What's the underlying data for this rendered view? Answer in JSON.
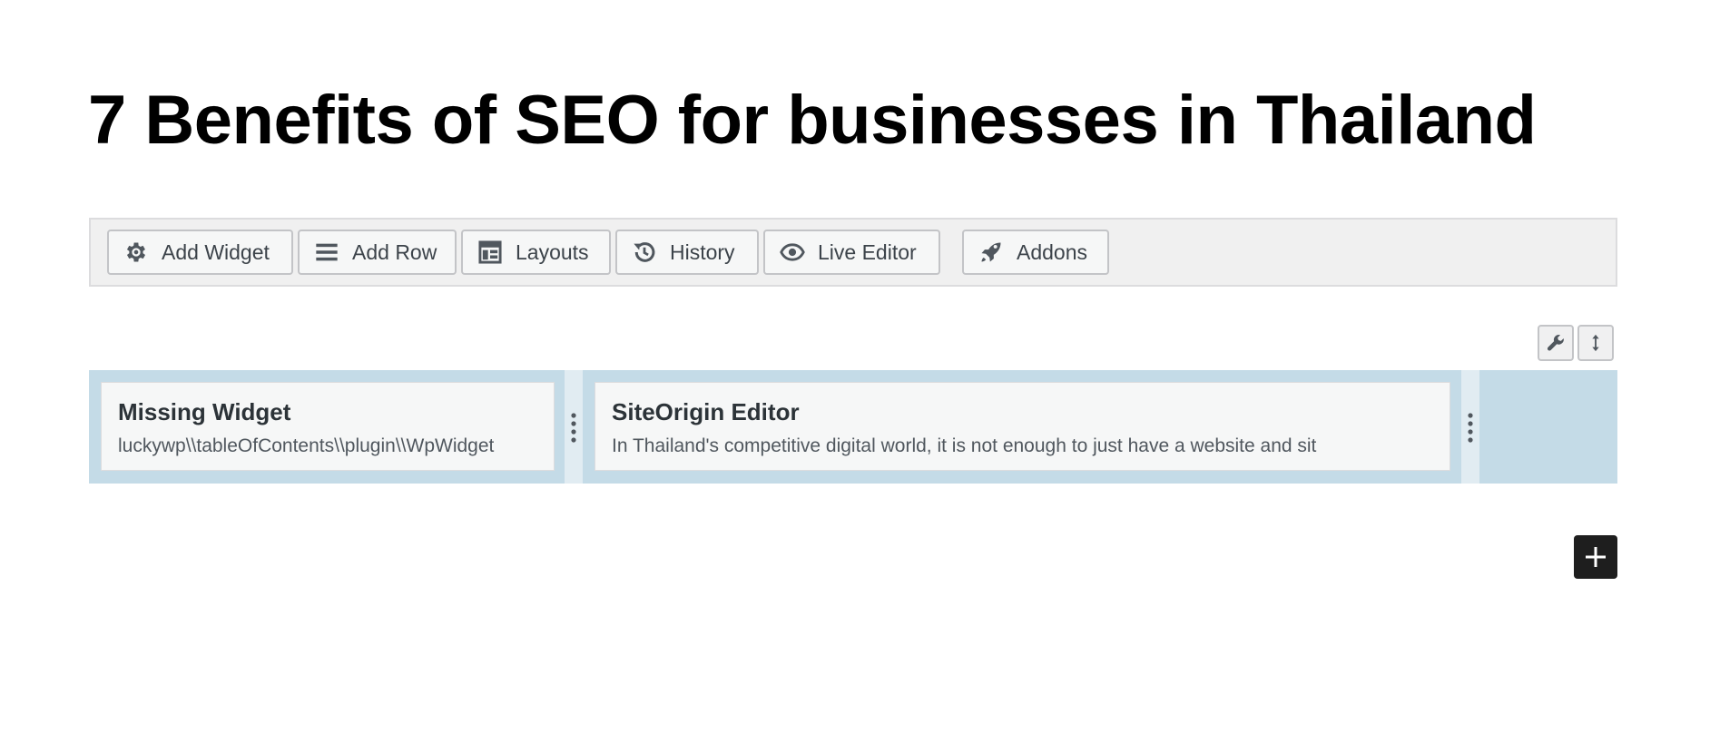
{
  "post": {
    "title": "7 Benefits of SEO for businesses in Thailand"
  },
  "toolbar": {
    "buttons": [
      {
        "label": "Add Widget",
        "icon": "gear-icon"
      },
      {
        "label": "Add Row",
        "icon": "hamburger-icon"
      },
      {
        "label": "Layouts",
        "icon": "layout-icon"
      },
      {
        "label": "History",
        "icon": "history-icon"
      },
      {
        "label": "Live Editor",
        "icon": "eye-icon"
      },
      {
        "label": "Addons",
        "icon": "rocket-icon"
      }
    ]
  },
  "row_tools": {
    "edit_icon": "wrench-icon",
    "move_icon": "move-vertical-icon"
  },
  "row": {
    "widgets": [
      {
        "title": "Missing Widget",
        "description": "luckywp\\\\tableOfContents\\\\plugin\\\\WpWidget"
      },
      {
        "title": "SiteOrigin Editor",
        "description": "In Thailand's competitive digital world, it is not enough to just have a website and sit"
      }
    ]
  },
  "add_block": {
    "icon": "plus-icon"
  },
  "colors": {
    "row_background": "#c4dbe7",
    "toolbar_background": "#f0f0f0",
    "add_button": "#1e1e1e"
  }
}
